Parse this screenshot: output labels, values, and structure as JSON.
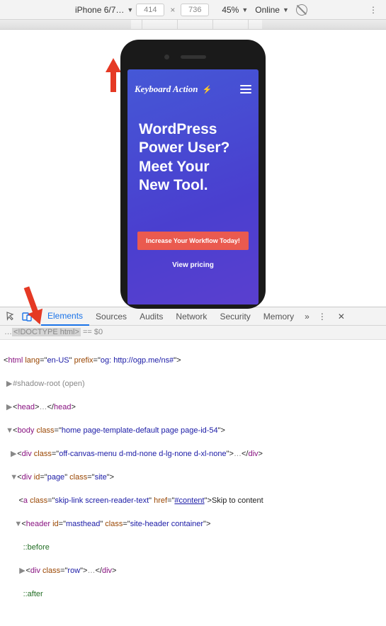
{
  "toolbar": {
    "device": "iPhone 6/7…",
    "width": "414",
    "height": "736",
    "zoom": "45%",
    "network": "Online",
    "moreGlyph": "⋮"
  },
  "phone": {
    "brand": "Keyboard Action",
    "heroLine1": "WordPress",
    "heroLine2": "Power User?",
    "heroLine3": "Meet Your",
    "heroLine4": "New Tool.",
    "cta": "Increase Your Workflow Today!",
    "link": "View pricing"
  },
  "tabs": {
    "elements": "Elements",
    "sources": "Sources",
    "audits": "Audits",
    "network": "Network",
    "security": "Security",
    "memory": "Memory",
    "more": "»",
    "menuGlyph": "⋮",
    "closeGlyph": "✕"
  },
  "crumb": {
    "ellipsis": "…",
    "doctype": "<!DOCTYPE html>",
    "eqVar": " == $0"
  },
  "dom": {
    "htmlOpen": "<html lang=\"en-US\" prefix=\"og: http://ogp.me/ns#\">",
    "shadow": "#shadow-root (open)",
    "head": "<head>…</head>",
    "bodyOpen": "<body class=\"home page-template-default page page-id-54\">",
    "offcanvas": "<div class=\"off-canvas-menu d-md-none d-lg-none d-xl-none\">…</div>",
    "pageOpen": "<div id=\"page\" class=\"site\">",
    "skipLink": "<a class=\"skip-link screen-reader-text\" href=\"#content\">Skip to content",
    "headerOpen": "<header id=\"masthead\" class=\"site-header container\">",
    "before": "::before",
    "rowDiv": "<div class=\"row\">…</div>",
    "after": "::after"
  }
}
